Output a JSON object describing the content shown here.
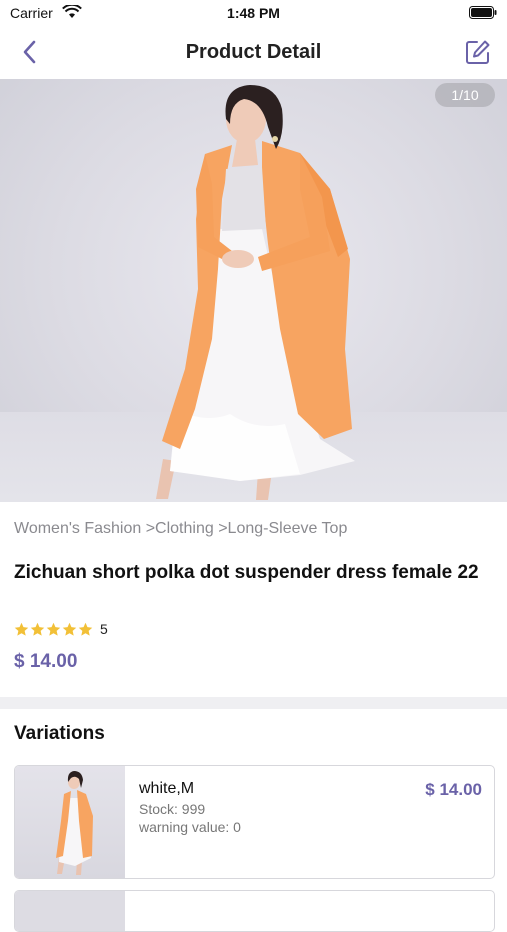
{
  "status_bar": {
    "carrier": "Carrier",
    "time": "1:48 PM"
  },
  "nav": {
    "title": "Product Detail",
    "back_icon": "chevron-left-icon",
    "edit_icon": "edit-icon"
  },
  "gallery": {
    "counter": "1/10"
  },
  "product": {
    "breadcrumb": "Women's Fashion >Clothing >Long-Sleeve Top",
    "title": "Zichuan short polka dot suspender dress female 22",
    "rating": "5",
    "stars": 5,
    "price": "$ 14.00"
  },
  "variations": {
    "heading": "Variations",
    "items": [
      {
        "name": "white,M",
        "stock": "Stock: 999",
        "warning": "warning value: 0",
        "price": "$ 14.00"
      }
    ]
  },
  "colors": {
    "accent": "#6a62a8",
    "star": "#f2c037",
    "cardigan": "#f7a461"
  }
}
